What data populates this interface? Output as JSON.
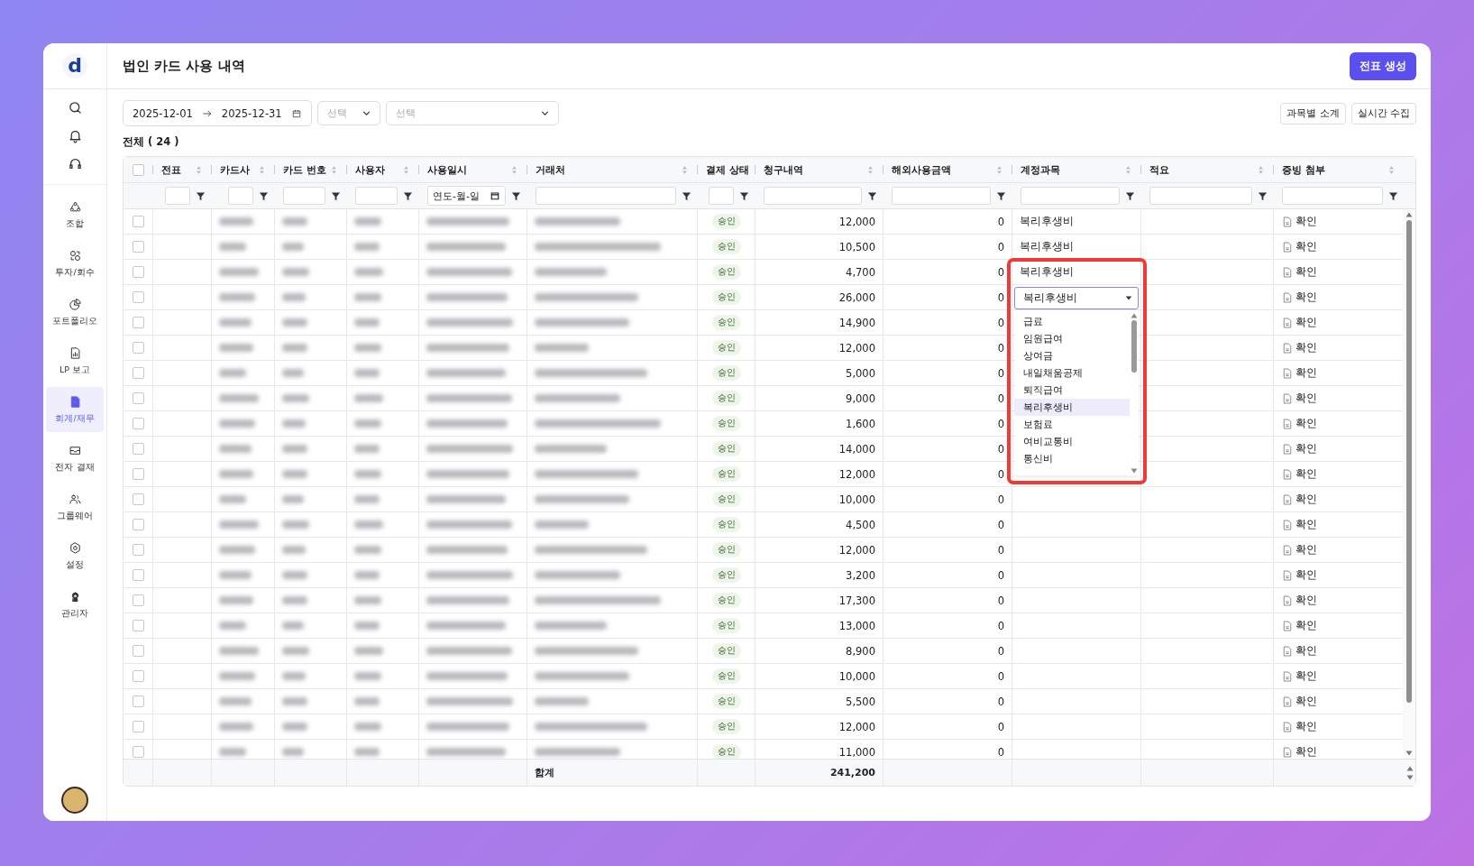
{
  "sidebar": {
    "logo": "d",
    "items": [
      {
        "label": "조합",
        "selected": false
      },
      {
        "label": "투자/회수",
        "selected": false
      },
      {
        "label": "포트폴리오",
        "selected": false
      },
      {
        "label": "LP 보고",
        "selected": false
      },
      {
        "label": "회계/재무",
        "selected": true
      },
      {
        "label": "전자 결재",
        "selected": false
      },
      {
        "label": "그룹웨어",
        "selected": false
      },
      {
        "label": "설정",
        "selected": false
      },
      {
        "label": "관리자",
        "selected": false
      }
    ]
  },
  "header": {
    "title": "법인 카드 사용 내역",
    "button": "전표 생성"
  },
  "toolbar": {
    "date_start": "2025-12-01",
    "date_end": "2025-12-31",
    "select_1": {
      "placeholder": "선택"
    },
    "select_2": {
      "placeholder": "선택"
    },
    "buttons": [
      "과목별 소계",
      "실시간 수집"
    ]
  },
  "total": "전체 ( 24 )",
  "table": {
    "select_all_checked": false,
    "columns": [
      {
        "label": "전표",
        "sortable": true,
        "kind": "empty"
      },
      {
        "label": "카드사",
        "sortable": true,
        "kind": "blurred"
      },
      {
        "label": "카드 번호",
        "sortable": true,
        "kind": "blurred"
      },
      {
        "label": "사용자",
        "sortable": true,
        "kind": "blurred"
      },
      {
        "label": "사용일시",
        "sortable": true,
        "kind": "blurred",
        "filter_placeholder": "연도-월-일"
      },
      {
        "label": "거래처",
        "sortable": true,
        "kind": "blurred"
      },
      {
        "label": "결제 상태",
        "sortable": false,
        "kind": "status"
      },
      {
        "label": "청구내역",
        "sortable": true,
        "kind": "amount"
      },
      {
        "label": "해외사용금액",
        "sortable": true,
        "kind": "overseas"
      },
      {
        "label": "계정과목",
        "sortable": true,
        "kind": "account"
      },
      {
        "label": "적요",
        "sortable": true,
        "kind": "empty"
      },
      {
        "label": "증빙 첨부",
        "sortable": true,
        "kind": "proof"
      }
    ],
    "rows": [
      {
        "checked": false,
        "status": "승인",
        "amount": "12,000",
        "overseas": "0",
        "account": "복리후생비",
        "proof": "확인"
      },
      {
        "checked": false,
        "status": "승인",
        "amount": "10,500",
        "overseas": "0",
        "account": "복리후생비",
        "proof": "확인"
      },
      {
        "checked": false,
        "status": "승인",
        "amount": "4,700",
        "overseas": "0",
        "account": "복리후생비",
        "proof": "확인"
      },
      {
        "checked": false,
        "status": "승인",
        "amount": "26,000",
        "overseas": "0",
        "account_select": {
          "value": "복리후생비",
          "expanded": true,
          "options": [
            {
              "label": "급료",
              "selected": false
            },
            {
              "label": "임원급여",
              "selected": false
            },
            {
              "label": "상여금",
              "selected": false
            },
            {
              "label": "내일채움공제",
              "selected": false
            },
            {
              "label": "퇴직급여",
              "selected": false
            },
            {
              "label": "복리후생비",
              "selected": true
            },
            {
              "label": "보험료",
              "selected": false
            },
            {
              "label": "여비교통비",
              "selected": false
            },
            {
              "label": "통신비",
              "selected": false
            }
          ]
        },
        "proof": "확인"
      },
      {
        "checked": false,
        "status": "승인",
        "amount": "14,900",
        "overseas": "0",
        "proof": "확인"
      },
      {
        "checked": false,
        "status": "승인",
        "amount": "12,000",
        "overseas": "0",
        "proof": "확인"
      },
      {
        "checked": false,
        "status": "승인",
        "amount": "5,000",
        "overseas": "0",
        "proof": "확인"
      },
      {
        "checked": false,
        "status": "승인",
        "amount": "9,000",
        "overseas": "0",
        "proof": "확인"
      },
      {
        "checked": false,
        "status": "승인",
        "amount": "1,600",
        "overseas": "0",
        "proof": "확인"
      },
      {
        "checked": false,
        "status": "승인",
        "amount": "14,000",
        "overseas": "0",
        "proof": "확인"
      },
      {
        "checked": false,
        "status": "승인",
        "amount": "12,000",
        "overseas": "0",
        "proof": "확인"
      },
      {
        "checked": false,
        "status": "승인",
        "amount": "10,000",
        "overseas": "0",
        "proof": "확인"
      },
      {
        "checked": false,
        "status": "승인",
        "amount": "4,500",
        "overseas": "0",
        "proof": "확인"
      },
      {
        "checked": false,
        "status": "승인",
        "amount": "12,000",
        "overseas": "0",
        "proof": "확인"
      },
      {
        "checked": false,
        "status": "승인",
        "amount": "3,200",
        "overseas": "0",
        "proof": "확인"
      },
      {
        "checked": false,
        "status": "승인",
        "amount": "17,300",
        "overseas": "0",
        "proof": "확인"
      },
      {
        "checked": false,
        "status": "승인",
        "amount": "13,000",
        "overseas": "0",
        "proof": "확인"
      },
      {
        "checked": false,
        "status": "승인",
        "amount": "8,900",
        "overseas": "0",
        "proof": "확인"
      },
      {
        "checked": false,
        "status": "승인",
        "amount": "10,000",
        "overseas": "0",
        "proof": "확인"
      },
      {
        "checked": false,
        "status": "승인",
        "amount": "5,500",
        "overseas": "0",
        "proof": "확인"
      },
      {
        "checked": false,
        "status": "승인",
        "amount": "12,000",
        "overseas": "0",
        "proof": "확인"
      },
      {
        "checked": false,
        "status": "승인",
        "amount": "11,000",
        "overseas": "0",
        "proof": "확인"
      }
    ],
    "footer": {
      "label": "합계",
      "amount_total": "241,200"
    }
  }
}
